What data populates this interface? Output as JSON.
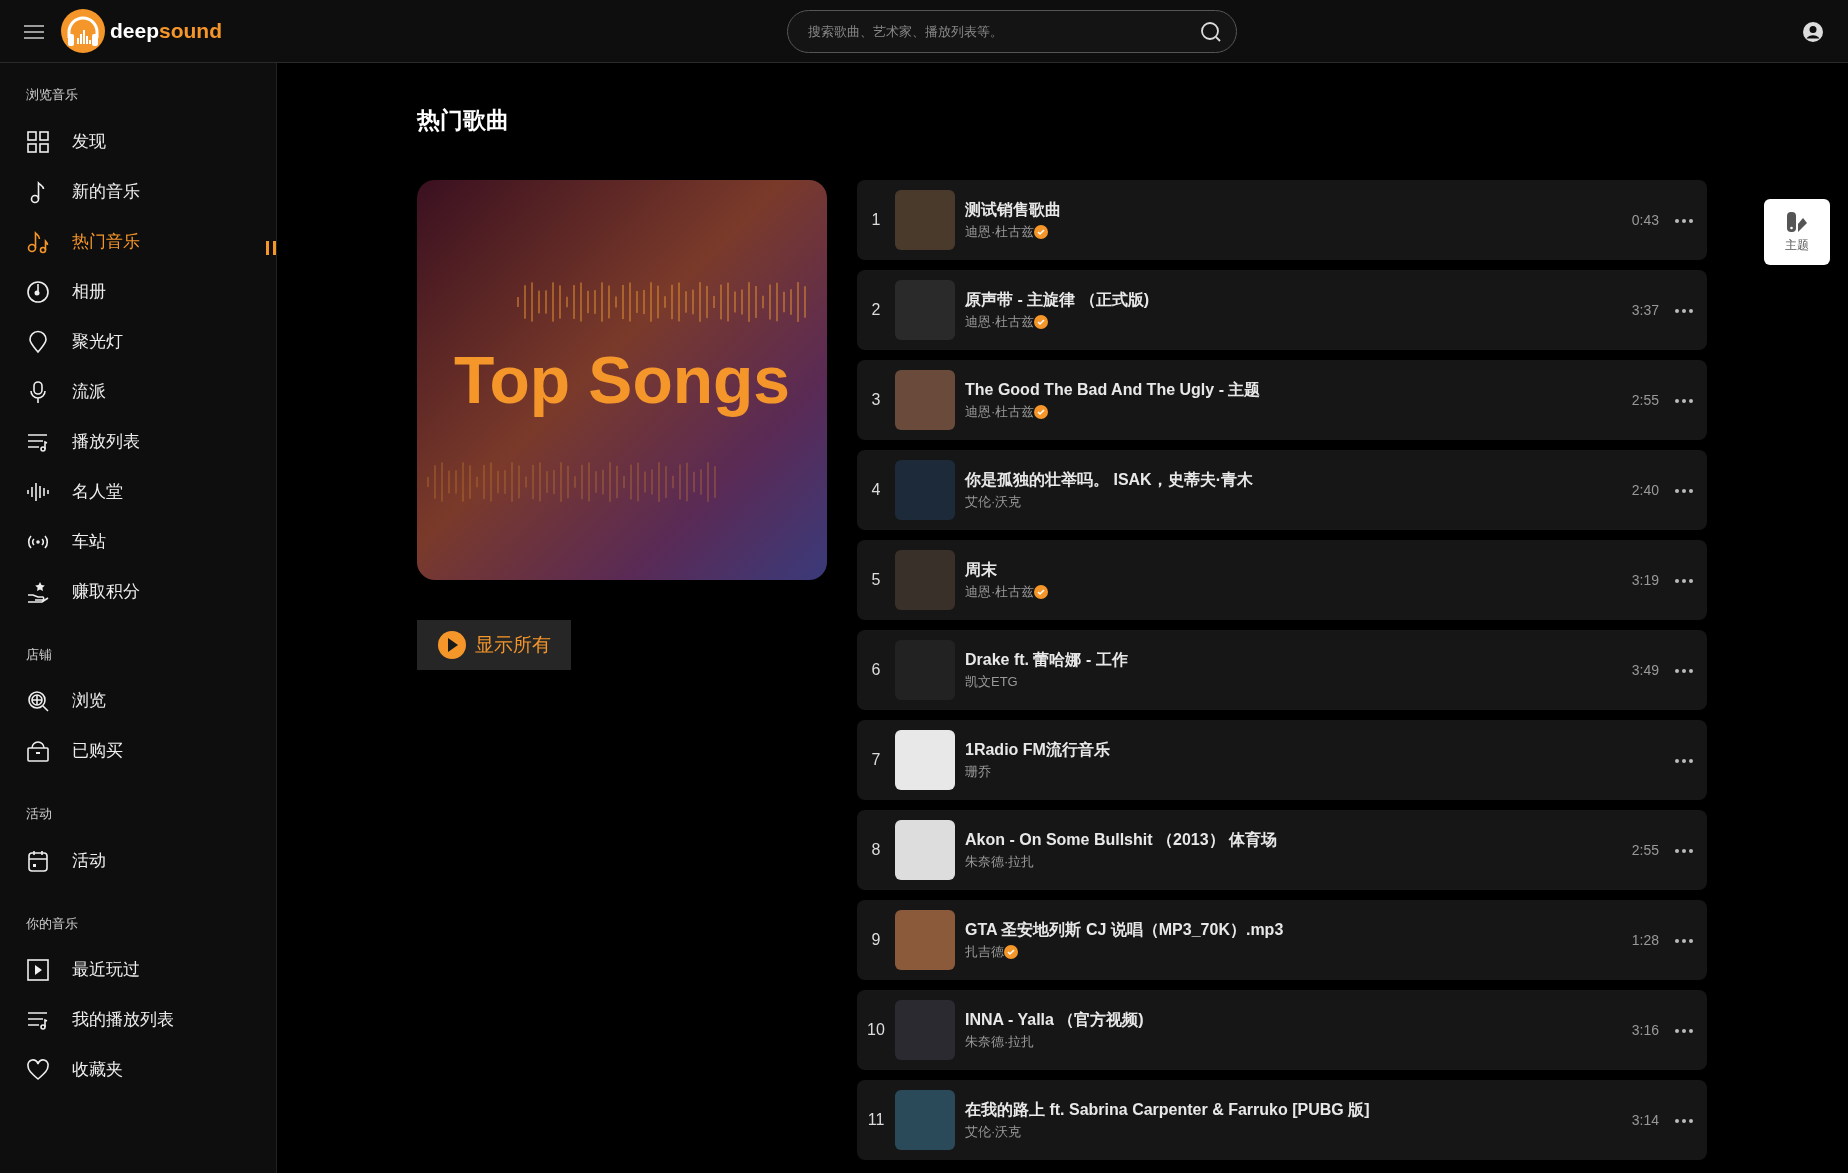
{
  "header": {
    "logo": {
      "text_lead": "deep",
      "text_accent": "sound"
    },
    "search": {
      "placeholder": "搜索歌曲、艺术家、播放列表等。"
    }
  },
  "sidebar": {
    "sections": [
      {
        "heading": "浏览音乐",
        "items": [
          {
            "label": "发现",
            "kind": "grid",
            "selected": false
          },
          {
            "label": "新的音乐",
            "kind": "note",
            "selected": false
          },
          {
            "label": "热门音乐",
            "kind": "notes",
            "selected": true
          },
          {
            "label": "相册",
            "kind": "disc",
            "selected": false
          },
          {
            "label": "聚光灯",
            "kind": "pin",
            "selected": false
          },
          {
            "label": "流派",
            "kind": "mic",
            "selected": false
          },
          {
            "label": "播放列表",
            "kind": "playlist",
            "selected": false
          },
          {
            "label": "名人堂",
            "kind": "wave",
            "selected": false
          },
          {
            "label": "车站",
            "kind": "radio",
            "selected": false
          },
          {
            "label": "赚取积分",
            "kind": "hand",
            "selected": false
          }
        ]
      },
      {
        "heading": "店铺",
        "items": [
          {
            "label": "浏览",
            "kind": "globe",
            "selected": false
          },
          {
            "label": "已购买",
            "kind": "bag",
            "selected": false
          }
        ]
      },
      {
        "heading": "活动",
        "items": [
          {
            "label": "活动",
            "kind": "calendar",
            "selected": false
          }
        ]
      },
      {
        "heading": "你的音乐",
        "items": [
          {
            "label": "最近玩过",
            "kind": "play",
            "selected": false
          },
          {
            "label": "我的播放列表",
            "kind": "playlist",
            "selected": false
          },
          {
            "label": "收藏夹",
            "kind": "heart",
            "selected": false
          }
        ]
      }
    ]
  },
  "page_title": "热门歌曲",
  "cover": {
    "title": "Top Songs"
  },
  "show_all_button": "显示所有",
  "songs": [
    {
      "rank": "1",
      "title": "测试销售歌曲",
      "artist": "迪恩·杜古兹",
      "verified": true,
      "duration": "0:43"
    },
    {
      "rank": "2",
      "title": "原声带 - 主旋律 （正式版)",
      "artist": "迪恩·杜古兹",
      "verified": true,
      "duration": "3:37"
    },
    {
      "rank": "3",
      "title": "The Good The Bad And The Ugly - 主题",
      "artist": "迪恩·杜古兹",
      "verified": true,
      "duration": "2:55"
    },
    {
      "rank": "4",
      "title": "你是孤独的壮举吗。 ISAK，史蒂夫·青木",
      "artist": "艾伦·沃克",
      "verified": false,
      "duration": "2:40"
    },
    {
      "rank": "5",
      "title": "周末",
      "artist": "迪恩·杜古兹",
      "verified": true,
      "duration": "3:19"
    },
    {
      "rank": "6",
      "title": "Drake ft. 蕾哈娜 - 工作",
      "artist": "凯文ETG",
      "verified": false,
      "duration": "3:49"
    },
    {
      "rank": "7",
      "title": "1Radio FM流行音乐",
      "artist": "珊乔",
      "verified": false
    },
    {
      "rank": "8",
      "title": "Akon - On Some Bullshit （2013） 体育场",
      "artist": "朱奈德·拉扎",
      "verified": false,
      "duration": "2:55"
    },
    {
      "rank": "9",
      "title": "GTA 圣安地列斯 CJ 说唱（MP3_70K）.mp3",
      "artist": "扎吉德",
      "verified": true,
      "duration": "1:28"
    },
    {
      "rank": "10",
      "title": "INNA - Yalla （官方视频)",
      "artist": "朱奈德·拉扎",
      "verified": false,
      "duration": "3:16"
    },
    {
      "rank": "11",
      "title": "在我的路上 ft. Sabrina Carpenter & Farruko [PUBG 版]",
      "artist": "艾伦·沃克",
      "verified": false,
      "duration": "3:14"
    }
  ],
  "theme_button": {
    "label": "主题"
  }
}
